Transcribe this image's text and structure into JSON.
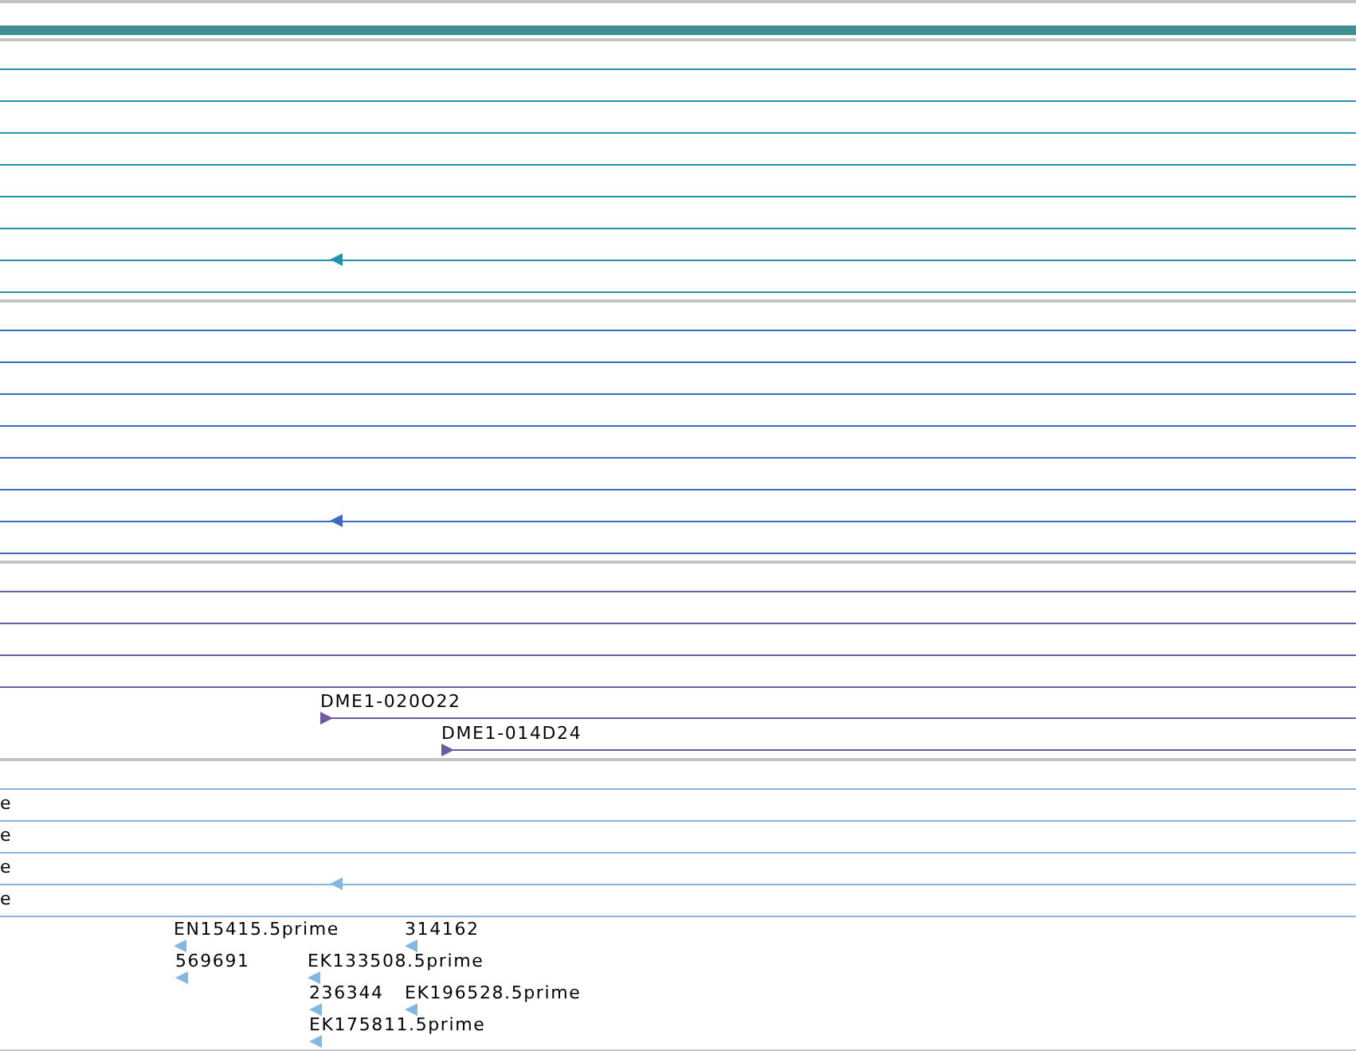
{
  "tracks": [
    {
      "color": "#2293ad",
      "features": [
        {
          "reverse": true
        }
      ]
    },
    {
      "color": "#3a6bc0",
      "features": [
        {
          "reverse": true
        }
      ]
    },
    {
      "color": "#6e5aa3",
      "features": [
        {
          "label": "DME1-020O22",
          "reverse": false
        },
        {
          "label": "DME1-014D24",
          "reverse": false
        }
      ]
    },
    {
      "color": "#87b7dc",
      "row_labels": [
        "e",
        "e",
        "e",
        "e"
      ],
      "features": [
        {
          "reverse": true
        },
        {
          "label": "EN15415.5prime",
          "reverse": true
        },
        {
          "label": "314162",
          "reverse": true
        },
        {
          "label": "569691",
          "reverse": true
        },
        {
          "label": "EK133508.5prime",
          "reverse": true
        },
        {
          "label": "236344",
          "reverse": true
        },
        {
          "label": "EK196528.5prime",
          "reverse": true
        },
        {
          "label": "EK175811.5prime",
          "reverse": true
        }
      ]
    }
  ]
}
